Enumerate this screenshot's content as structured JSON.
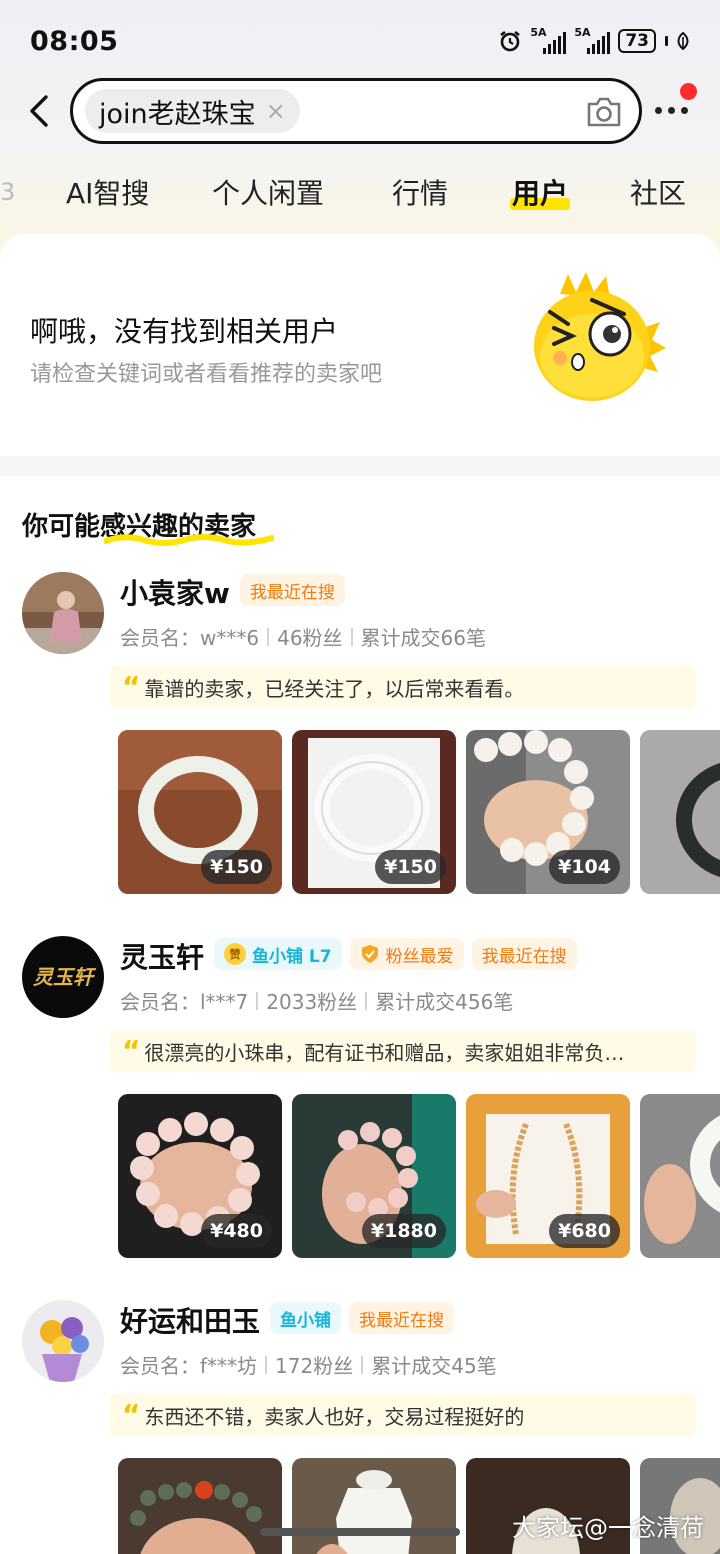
{
  "status_bar": {
    "time": "08:05",
    "signal1": "5A",
    "signal2": "5A",
    "battery": "73"
  },
  "search": {
    "query": "join老赵珠宝",
    "clear": "×"
  },
  "tabs": [
    {
      "label": "AI智搜"
    },
    {
      "label": "个人闲置"
    },
    {
      "label": "行情"
    },
    {
      "label": "用户",
      "active": true
    },
    {
      "label": "社区"
    }
  ],
  "empty": {
    "title": "啊哦，没有找到相关用户",
    "subtitle": "请检查关键词或者看看推荐的卖家吧"
  },
  "section_title": "你可能感兴趣的卖家",
  "sellers": [
    {
      "name": "小袁家w",
      "badges": [
        {
          "type": "search",
          "label": "我最近在搜"
        }
      ],
      "member": "会员名：w***6",
      "fans": "46粉丝",
      "deals": "累计成交66笔",
      "review": "靠谱的卖家，已经关注了，以后常来看看。",
      "photos": [
        {
          "price": "¥150",
          "color": "#8a4a2e",
          "item": "bangle"
        },
        {
          "price": "¥150",
          "color": "#5a2a22",
          "item": "bangle"
        },
        {
          "price": "¥104",
          "color": "#6b6b6b",
          "item": "beads"
        },
        {
          "price": "",
          "color": "#999",
          "item": "dark-bangle"
        }
      ]
    },
    {
      "name": "灵玉轩",
      "badges": [
        {
          "type": "shop",
          "label": "鱼小铺 L7",
          "icon": "赞"
        },
        {
          "type": "fans",
          "label": "粉丝最爱"
        },
        {
          "type": "search",
          "label": "我最近在搜"
        }
      ],
      "member": "会员名：l***7",
      "fans": "2033粉丝",
      "deals": "累计成交456笔",
      "review": "很漂亮的小珠串，配有证书和赠品，卖家姐姐非常负…",
      "photos": [
        {
          "price": "¥480",
          "color": "#1f1f1f",
          "item": "pink-beads"
        },
        {
          "price": "¥1880",
          "color": "#2a3a36",
          "item": "pink-beads"
        },
        {
          "price": "¥680",
          "color": "#e8a03a",
          "item": "necklace"
        },
        {
          "price": "",
          "color": "#888",
          "item": "bangle"
        }
      ]
    },
    {
      "name": "好运和田玉",
      "badges": [
        {
          "type": "shop",
          "label": "鱼小铺"
        },
        {
          "type": "search",
          "label": "我最近在搜"
        }
      ],
      "member": "会员名：f***坊",
      "fans": "172粉丝",
      "deals": "累计成交45笔",
      "review": "东西还不错，卖家人也好，交易过程挺好的",
      "photos": [
        {
          "price": "",
          "color": "#4a3a30",
          "item": "green-beads"
        },
        {
          "price": "",
          "color": "#6a5a4a",
          "item": "pendant"
        },
        {
          "price": "",
          "color": "#3a2a22",
          "item": "carving"
        },
        {
          "price": "",
          "color": "#777",
          "item": ""
        }
      ]
    }
  ],
  "watermark": "大家坛@一念清荷"
}
